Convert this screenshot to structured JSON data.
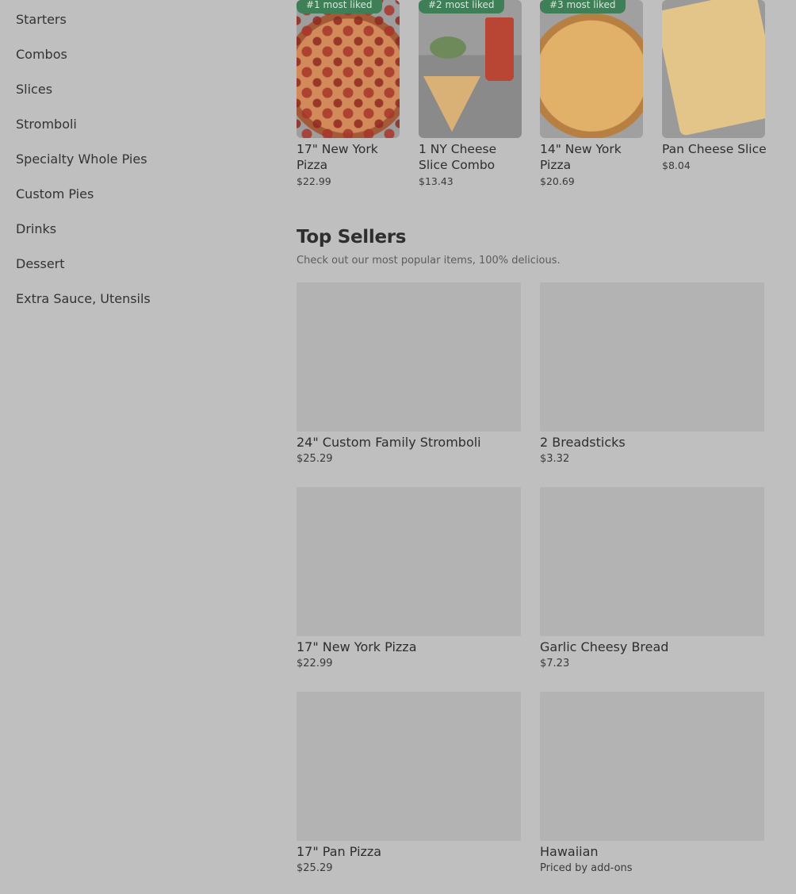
{
  "sidebar": {
    "items": [
      {
        "label": "Starters"
      },
      {
        "label": "Combos"
      },
      {
        "label": "Slices"
      },
      {
        "label": "Stromboli"
      },
      {
        "label": "Specialty Whole Pies"
      },
      {
        "label": "Custom Pies"
      },
      {
        "label": "Drinks"
      },
      {
        "label": "Dessert"
      },
      {
        "label": "Extra Sauce, Utensils"
      }
    ]
  },
  "most_liked": [
    {
      "badge": "#1 most liked",
      "name": "17\" New York Pizza",
      "price": "$22.99"
    },
    {
      "badge": "#2 most liked",
      "name": "1 NY Cheese Slice Combo",
      "price": "$13.43"
    },
    {
      "badge": "#3 most liked",
      "name": "14\" New York Pizza",
      "price": "$20.69"
    },
    {
      "name": "Pan Cheese Slice",
      "price": "$8.04"
    }
  ],
  "top_sellers": {
    "title": "Top Sellers",
    "subtitle": "Check out our most popular items, 100% delicious.",
    "items": [
      {
        "name": "24\" Custom Family Stromboli",
        "price": "$25.29"
      },
      {
        "name": "2 Breadsticks",
        "price": "$3.32"
      },
      {
        "name": "17\" New York Pizza",
        "price": "$22.99"
      },
      {
        "name": "Garlic Cheesy Bread",
        "price": "$7.23"
      },
      {
        "name": "17\" Pan Pizza",
        "price": "$25.29"
      },
      {
        "name": "Hawaiian",
        "price": "Priced by add-ons"
      }
    ]
  },
  "colors": {
    "overlay_background": "#bfbfbf",
    "badge_green": "#3f7f58",
    "placeholder": "#b3b3b3"
  }
}
